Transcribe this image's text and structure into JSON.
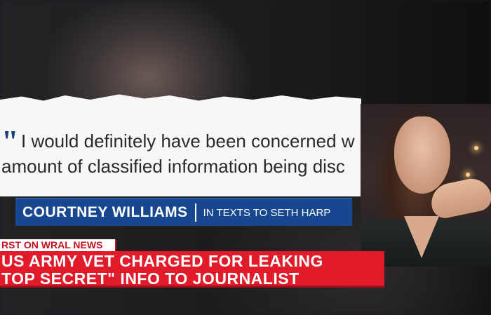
{
  "quote": {
    "open_mark": "\"",
    "line1": "I would definitely have been concerned w",
    "line2": "amount of classified information being disc"
  },
  "nameplate": {
    "name": "COURTNEY WILLIAMS",
    "subtitle": "IN TEXTS TO SETH HARP"
  },
  "lower_third": {
    "kicker": "RST ON WRAL NEWS",
    "headline_line1": "US ARMY VET CHARGED FOR LEAKING",
    "headline_line2": "TOP SECRET\" INFO TO JOURNALIST"
  },
  "colors": {
    "nameplate_blue": "#16478f",
    "headline_red": "#e11b2a",
    "kicker_red": "#c4121f"
  },
  "icons": {
    "quote_mark": "quote-open-icon"
  }
}
